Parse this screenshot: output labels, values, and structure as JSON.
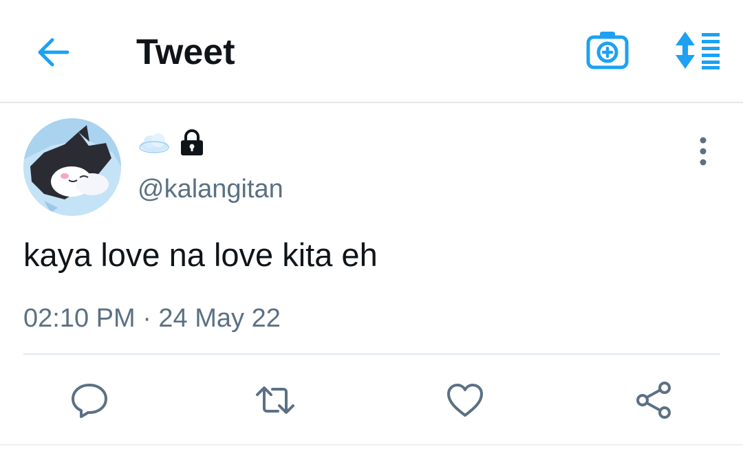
{
  "header": {
    "title": "Tweet",
    "back_icon": "arrow-left-icon",
    "camera_icon": "camera-add-icon",
    "sort_icon": "sort-list-icon",
    "accent_color": "#1da1f2"
  },
  "tweet": {
    "display_name_icon": "cloud-emoji",
    "protected_icon": "lock-icon",
    "handle": "@kalangitan",
    "text": "kaya love na love kita eh",
    "timestamp": "02:10 PM · 24 May 22",
    "more_icon": "more-vertical-icon"
  },
  "actions": [
    {
      "name": "reply",
      "icon": "reply-icon"
    },
    {
      "name": "retweet",
      "icon": "retweet-icon"
    },
    {
      "name": "like",
      "icon": "heart-icon"
    },
    {
      "name": "share",
      "icon": "share-icon"
    }
  ],
  "colors": {
    "text": "#0f1419",
    "secondary": "#5b7083",
    "divider": "#e1e8ed"
  }
}
